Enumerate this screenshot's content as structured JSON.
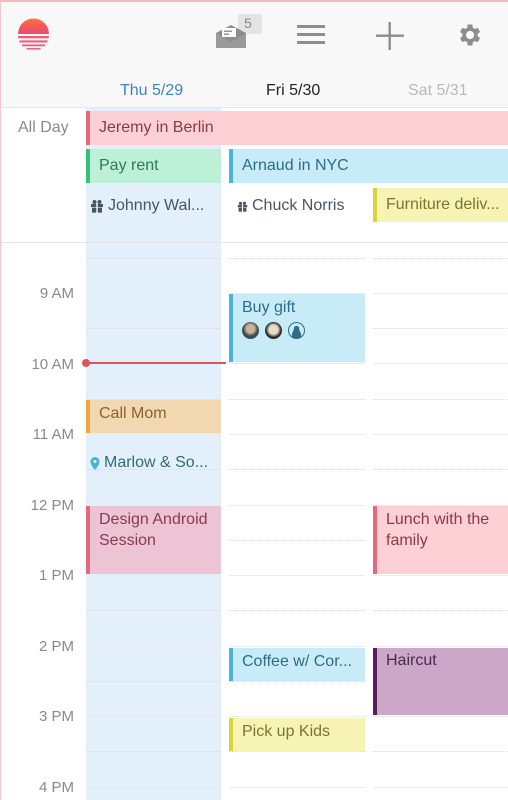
{
  "app": {
    "toolbar": {
      "logo": "sunrise-logo",
      "inbox_badge": "5",
      "icons": [
        "inbox-icon",
        "menu-icon",
        "add-icon",
        "settings-icon"
      ]
    },
    "days": [
      {
        "label": "Thu 5/29",
        "state": "today",
        "color": "#3d84c6"
      },
      {
        "label": "Fri 5/30",
        "state": "normal",
        "color": "#222222"
      },
      {
        "label": "Sat 5/31",
        "state": "dimmed",
        "color": "#b9b9b9"
      }
    ],
    "all_day": {
      "label": "All Day",
      "events": [
        {
          "title": "Jeremy in Berlin",
          "color": "#fdd0d6",
          "accent": "#e26a7a"
        },
        {
          "title": "Pay rent",
          "color": "#bdf0d6",
          "accent": "#33c27a"
        },
        {
          "title": "Arnaud in NYC",
          "color": "#c7ebf7",
          "accent": "#4cb3d8"
        },
        {
          "title": "Johnny Wal...",
          "icon": "gift-icon"
        },
        {
          "title": "Chuck Norris",
          "icon": "gift-icon"
        },
        {
          "title": "Furniture deliv...",
          "color": "#f7f3b5",
          "accent": "#dcd23a"
        }
      ]
    },
    "hours": [
      "9 AM",
      "10 AM",
      "11 AM",
      "12 PM",
      "1 PM",
      "2 PM",
      "3 PM",
      "4 PM"
    ],
    "events": [
      {
        "title": "Buy gift",
        "day": "Fri 5/30",
        "color": "#c7ebf7",
        "accent": "#4cb3d8",
        "attendees": [
          "avatar-1",
          "avatar-2",
          "avatar-placeholder"
        ]
      },
      {
        "title": "Call Mom",
        "day": "Thu 5/29",
        "color": "#f1d8b1",
        "accent": "#efa63b"
      },
      {
        "title": "Marlow & So...",
        "day": "Thu 5/29",
        "icon": "location-pin-icon"
      },
      {
        "title": "Design Android Session",
        "day": "Thu 5/29",
        "color": "#edc4d3",
        "accent": "#e06a82"
      },
      {
        "title": "Lunch with the family",
        "day": "Sat 5/31",
        "color": "#fdd0d6",
        "accent": "#e26a7a"
      },
      {
        "title": "Coffee w/ Cor...",
        "day": "Fri 5/30",
        "color": "#c7ebf7",
        "accent": "#4cb3d8"
      },
      {
        "title": "Haircut",
        "day": "Sat 5/31",
        "color": "#cba7c8",
        "accent": "#5a1d5d"
      },
      {
        "title": "Pick up Kids",
        "day": "Fri 5/30",
        "color": "#f7f3b5",
        "accent": "#dcd23a"
      }
    ]
  }
}
